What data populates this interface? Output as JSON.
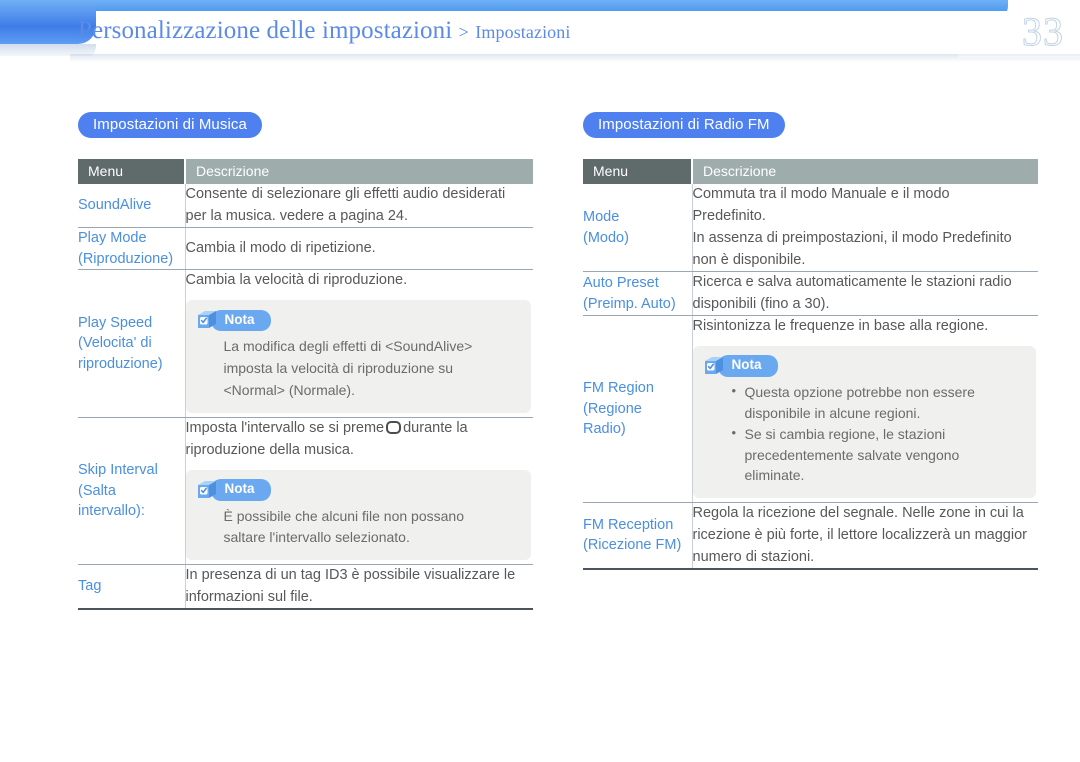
{
  "header": {
    "title_main": "Personalizzazione delle impostazioni",
    "separator": ">",
    "title_sub": "Impostazioni",
    "page_number": "33",
    "accent_blue": "#4f9cf0",
    "title_color": "#5b8ae8"
  },
  "sections": [
    {
      "pill_label": "Impostazioni di Musica",
      "columns": {
        "menu": "Menu",
        "description": "Descrizione"
      },
      "rows": [
        {
          "menu": [
            "SoundAlive"
          ],
          "desc": [
            "Consente di selezionare gli effetti audio desiderati",
            "per la musica. vedere a pagina 24."
          ]
        },
        {
          "menu": [
            "Play Mode",
            "(Riproduzione)"
          ],
          "desc": [
            "Cambia il modo di ripetizione."
          ]
        },
        {
          "menu": [
            "Play Speed",
            "(Velocita' di",
            "riproduzione)"
          ],
          "desc": [
            "Cambia la velocità di riproduzione."
          ],
          "note": {
            "label": "Nota",
            "icon": "note-cube-icon",
            "lines": [
              "La modifica degli effetti di <SoundAlive>",
              "imposta la velocità di riproduzione su",
              "<Normal> (Normale)."
            ]
          }
        },
        {
          "menu": [
            "Skip Interval",
            "(Salta",
            "intervallo):"
          ],
          "desc_pre": "Imposta l'intervallo se si preme",
          "desc_key_icon": "hardware-key-icon",
          "desc_post": "durante la",
          "desc_line2": "riproduzione della musica.",
          "note": {
            "label": "Nota",
            "icon": "note-cube-icon",
            "lines": [
              "È possibile che alcuni file non possano",
              "saltare l'intervallo selezionato."
            ]
          }
        },
        {
          "menu": [
            "Tag"
          ],
          "desc": [
            "In presenza di un tag ID3 è possibile visualizzare le",
            "informazioni sul file."
          ],
          "last": true
        }
      ]
    },
    {
      "pill_label": "Impostazioni di Radio FM",
      "columns": {
        "menu": "Menu",
        "description": "Descrizione"
      },
      "rows": [
        {
          "menu": [
            "Mode",
            "(Modo)"
          ],
          "desc": [
            "Commuta tra il modo Manuale e il modo",
            "Predefinito.",
            "In assenza di preimpostazioni, il modo Predefinito",
            "non è disponibile."
          ]
        },
        {
          "menu": [
            "Auto Preset",
            "(Preimp. Auto)"
          ],
          "desc": [
            "Ricerca e salva automaticamente le stazioni radio",
            "disponibili (fino a 30)."
          ]
        },
        {
          "menu": [
            "FM Region",
            "(Regione",
            "Radio)"
          ],
          "desc": [
            "Risintonizza le frequenze in base alla regione."
          ],
          "note": {
            "label": "Nota",
            "icon": "note-cube-icon",
            "bullets": [
              [
                "Questa opzione potrebbe non essere",
                "disponibile in alcune regioni."
              ],
              [
                "Se si cambia regione, le stazioni",
                "precedentemente salvate vengono",
                "eliminate."
              ]
            ]
          }
        },
        {
          "menu": [
            "FM Reception",
            "(Ricezione FM)"
          ],
          "desc": [
            "Regola la ricezione del segnale. Nelle zone in cui la",
            "ricezione è più forte, il lettore localizzerà un maggior",
            "numero di stazioni."
          ],
          "last": true
        }
      ]
    }
  ]
}
